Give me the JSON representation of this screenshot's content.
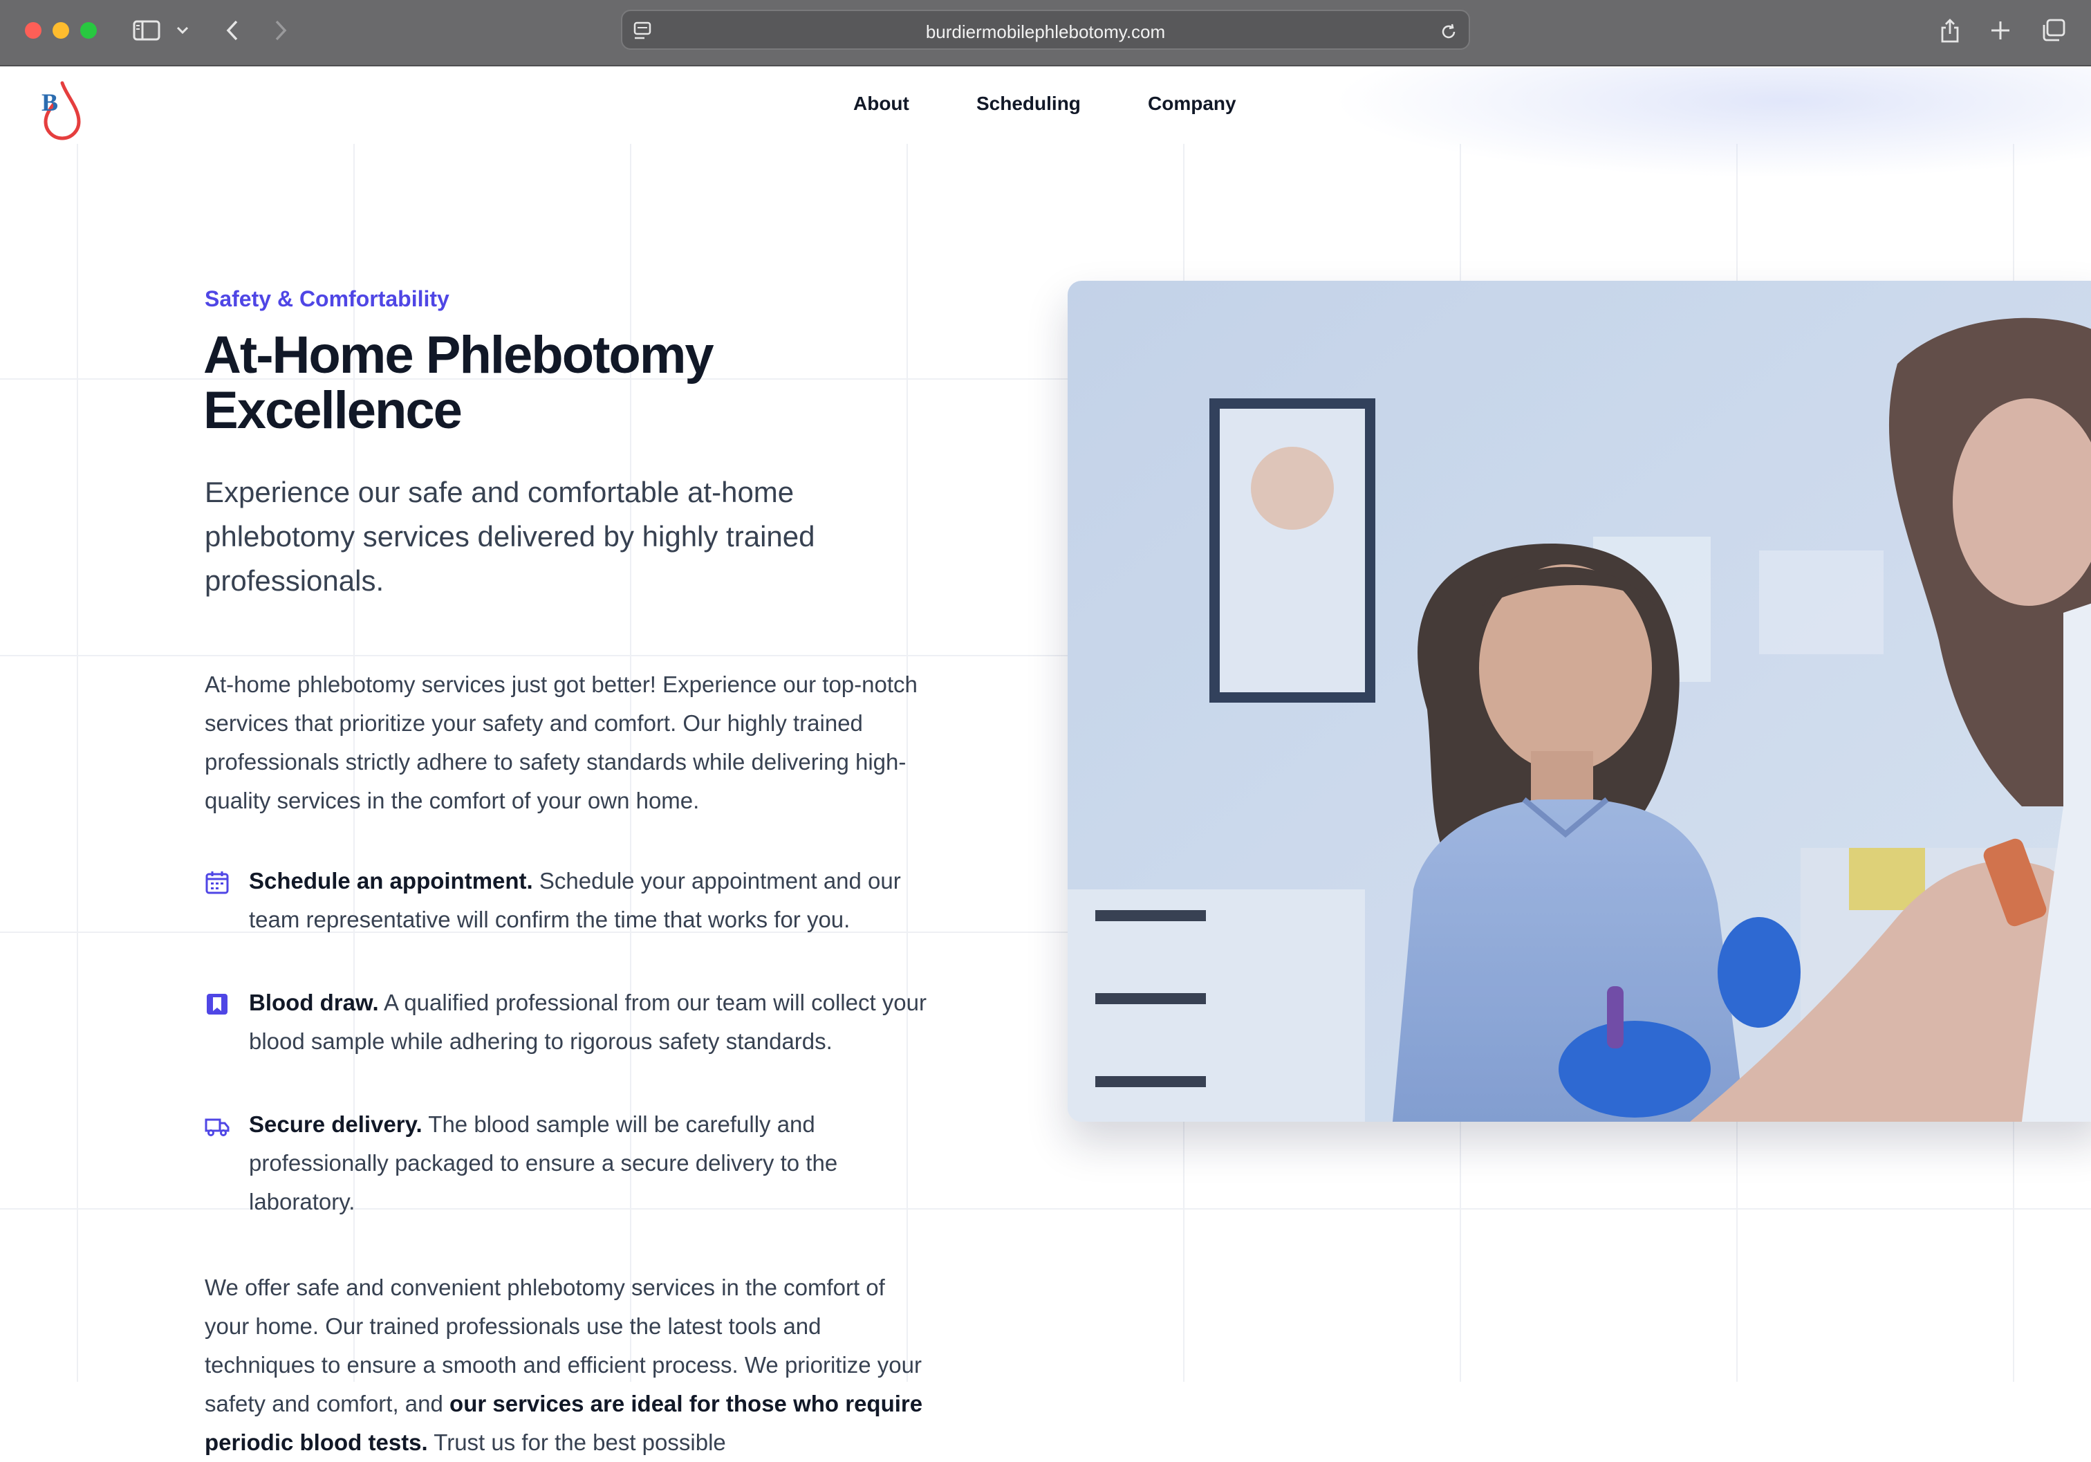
{
  "browser": {
    "url": "burdiermobilephlebotomy.com",
    "icons": [
      "sidebar-icon",
      "chevron-down-icon",
      "back-icon",
      "forward-icon",
      "page-settings-icon",
      "reload-icon",
      "share-icon",
      "new-tab-icon",
      "tab-overview-icon"
    ]
  },
  "nav": {
    "logo_letter": "B",
    "links": [
      "About",
      "Scheduling",
      "Company"
    ]
  },
  "hero": {
    "eyebrow": "Safety & Comfortability",
    "title_line1": "At-Home Phlebotomy",
    "title_line2": "Excellence",
    "lead": "Experience our safe and comfortable at-home phlebotomy services delivered by highly trained professionals.",
    "intro": "At-home phlebotomy services just got better! Experience our top-notch services that prioritize your safety and comfort. Our highly trained professionals strictly adhere to safety standards while delivering high-quality services in the comfort of your own home.",
    "features": [
      {
        "icon": "calendar-icon",
        "title": "Schedule an appointment.",
        "text": "Schedule your appointment and our team representative will confirm the time that works for you."
      },
      {
        "icon": "bookmark-icon",
        "title": "Blood draw.",
        "text": "A qualified professional from our team will collect your blood sample while adhering to rigorous safety standards."
      },
      {
        "icon": "truck-icon",
        "title": "Secure delivery.",
        "text": "The blood sample will be carefully and professionally packaged to ensure a secure delivery to the laboratory."
      }
    ],
    "closing_part1": "We offer safe and convenient phlebotomy services in the comfort of your home. Our trained professionals use the latest tools and techniques to ensure a smooth and efficient process. We prioritize your safety and comfort, and",
    "closing_bold": "our services are ideal for those who require periodic blood tests.",
    "closing_part2": "Trust us for the best possible"
  },
  "colors": {
    "accent": "#4f46e5",
    "heading": "#111827",
    "body": "#374151",
    "logo_blue": "#2b6cb0",
    "logo_red": "#e53e3e"
  }
}
